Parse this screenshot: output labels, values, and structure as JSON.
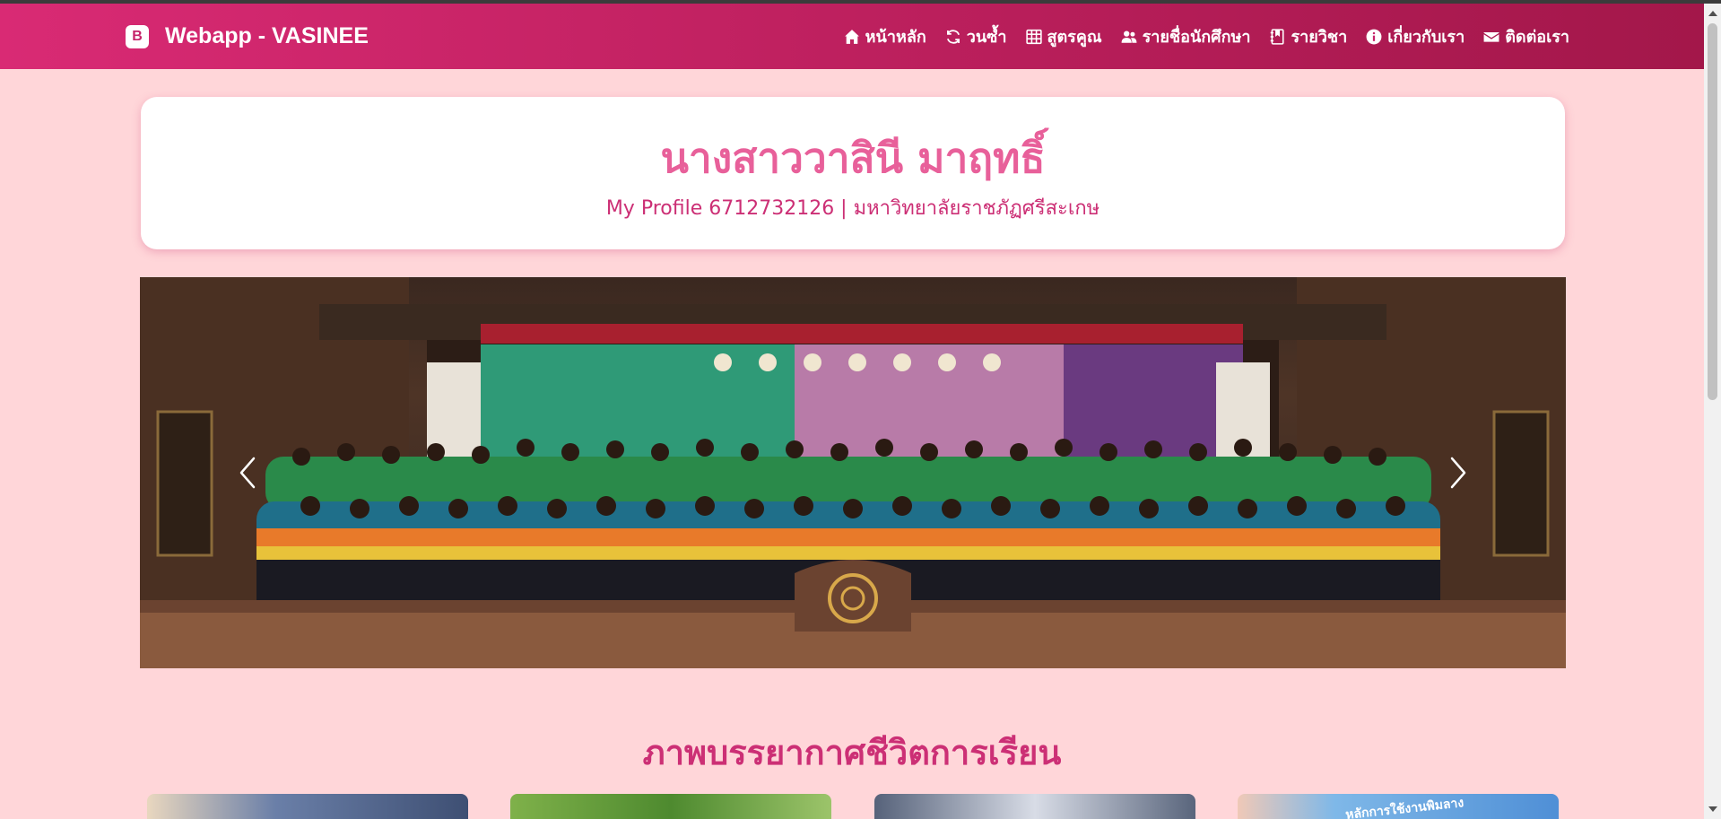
{
  "navbar": {
    "brand_icon": "B",
    "brand": "Webapp - VASINEE",
    "items": [
      {
        "label": "หน้าหลัก",
        "icon": "home-icon"
      },
      {
        "label": "วนซ้ำ",
        "icon": "refresh-icon"
      },
      {
        "label": "สูตรคูณ",
        "icon": "table-icon"
      },
      {
        "label": "รายชื่อนักศึกษา",
        "icon": "people-icon"
      },
      {
        "label": "รายวิชา",
        "icon": "journal-icon"
      },
      {
        "label": "เกี่ยวกับเรา",
        "icon": "info-icon"
      },
      {
        "label": "ติดต่อเรา",
        "icon": "envelope-icon"
      }
    ]
  },
  "profile": {
    "name": "นางสาววาสินี มาฤทธิ์",
    "subtitle": "My Profile 6712732126 | มหาวิทยาลัยราชภัฏศรีสะเกษ"
  },
  "carousel": {
    "prev_icon": "chevron-left-icon",
    "next_icon": "chevron-right-icon"
  },
  "gallery": {
    "title": "ภาพบรรยากาศชีวิตการเรียน",
    "card4_caption": "หลักการใช้งานพิมลาง"
  },
  "colors": {
    "background": "#ffd6d9",
    "navbar_start": "#d92a74",
    "navbar_end": "#a3174a",
    "accent": "#cc2f75",
    "name": "#e8609a"
  }
}
